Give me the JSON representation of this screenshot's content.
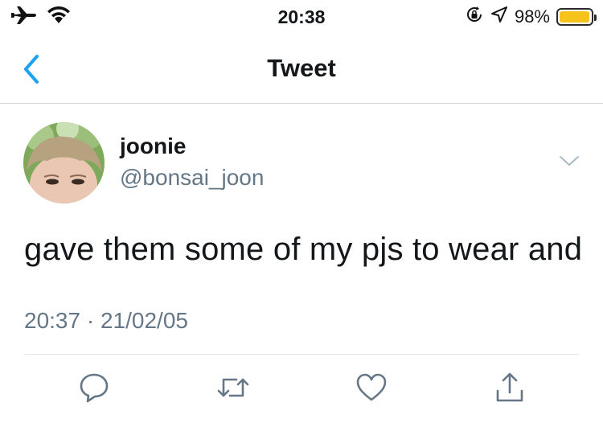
{
  "status_bar": {
    "time": "20:38",
    "battery_percent_label": "98%",
    "battery_level": 0.98,
    "icons": [
      "airplane-icon",
      "wifi-icon",
      "orientation-lock-icon",
      "location-icon",
      "battery-icon"
    ],
    "battery_color": "#f5c31a"
  },
  "nav": {
    "title": "Tweet",
    "back_icon": "chevron-left-icon",
    "accent_color": "#1da1f2"
  },
  "tweet": {
    "display_name": "joonie",
    "handle": "@bonsai_joon",
    "text": "gave them some of my pjs to wear and",
    "time": "20:37",
    "separator": "·",
    "date": "21/02/05"
  },
  "actions": [
    {
      "name": "reply",
      "icon": "reply-icon"
    },
    {
      "name": "retweet",
      "icon": "retweet-icon"
    },
    {
      "name": "like",
      "icon": "heart-icon"
    },
    {
      "name": "share",
      "icon": "share-icon"
    }
  ]
}
